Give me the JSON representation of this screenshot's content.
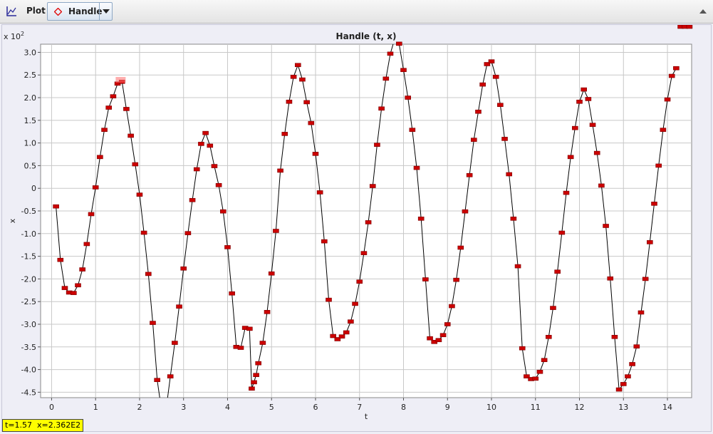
{
  "toolbar": {
    "plot_label": "Plot",
    "handle_label": "Handle",
    "handle_color": "#e00000"
  },
  "readout": "t=1.57  x=2.362E2",
  "chart_data": {
    "type": "line",
    "title": "Handle (t, x)",
    "xlabel": "t",
    "ylabel": "x",
    "y_multiplier": "x 10^2",
    "xlim": [
      -0.25,
      14.55
    ],
    "ylim": [
      -4.62,
      3.18
    ],
    "xticks": [
      0,
      1,
      2,
      3,
      4,
      5,
      6,
      7,
      8,
      9,
      10,
      11,
      12,
      13,
      14
    ],
    "yticks": [
      3.0,
      2.5,
      2.0,
      1.5,
      1.0,
      0.5,
      0,
      -0.5,
      -1.0,
      -1.5,
      -2.0,
      -2.5,
      -3.0,
      -3.5,
      -4.0,
      -4.5
    ],
    "ytick_labels": [
      "3.0",
      "2.5",
      "2.0",
      "1.5",
      "1.0",
      "0.5",
      "0",
      "-0.5",
      "-1.0",
      "-1.5",
      "-2.0",
      "-2.5",
      "-3.0",
      "-3.5",
      "-4.0",
      "-4.5"
    ],
    "grid": true,
    "line_color": "#000000",
    "marker_color": "#cc0000",
    "highlight": {
      "t": 1.57,
      "x": 2.362
    },
    "series": [
      {
        "t": [
          0.1,
          0.2,
          0.3,
          0.4,
          0.5,
          0.6,
          0.7,
          0.8,
          0.9,
          1.0,
          1.1,
          1.2,
          1.3,
          1.4,
          1.5,
          1.6,
          1.7,
          1.8,
          1.9,
          2.0,
          2.1,
          2.2,
          2.3,
          2.4,
          2.5,
          2.6,
          2.7,
          2.8,
          2.9,
          3.0,
          3.1,
          3.2,
          3.3,
          3.4,
          3.5,
          3.6,
          3.7,
          3.8,
          3.9,
          4.0,
          4.1,
          4.2,
          4.3,
          4.4,
          4.5,
          4.55,
          4.6,
          4.65,
          4.7,
          4.8,
          4.9,
          5.0,
          5.1,
          5.2,
          5.3,
          5.4,
          5.5,
          5.6,
          5.7,
          5.8,
          5.9,
          6.0,
          6.1,
          6.2,
          6.3,
          6.4,
          6.5,
          6.6,
          6.7,
          6.8,
          6.9,
          7.0,
          7.1,
          7.2,
          7.3,
          7.4,
          7.5,
          7.6,
          7.7,
          7.8,
          7.9,
          8.0,
          8.1,
          8.2,
          8.3,
          8.4,
          8.5,
          8.6,
          8.7,
          8.8,
          8.9,
          9.0,
          9.1,
          9.2,
          9.3,
          9.4,
          9.5,
          9.6,
          9.7,
          9.8,
          9.9,
          10.0,
          10.1,
          10.2,
          10.3,
          10.4,
          10.5,
          10.6,
          10.7,
          10.8,
          10.9,
          11.0,
          11.1,
          11.2,
          11.3,
          11.4,
          11.5,
          11.6,
          11.7,
          11.8,
          11.9,
          12.0,
          12.1,
          12.2,
          12.3,
          12.4,
          12.5,
          12.6,
          12.7,
          12.8,
          12.9,
          13.0,
          13.1,
          13.2,
          13.3,
          13.4,
          13.5,
          13.6,
          13.7,
          13.8,
          13.9,
          14.0,
          14.1,
          14.2,
          14.3,
          14.4,
          14.5
        ],
        "x": [
          -0.4,
          -1.58,
          -2.2,
          -2.3,
          -2.31,
          -2.14,
          -1.79,
          -1.23,
          -0.57,
          0.02,
          0.69,
          1.29,
          1.78,
          2.03,
          2.31,
          2.35,
          1.75,
          1.16,
          0.53,
          -0.14,
          -0.98,
          -1.89,
          -2.97,
          -4.23,
          -4.9,
          -4.9,
          -4.15,
          -3.41,
          -2.61,
          -1.77,
          -0.99,
          -0.26,
          0.42,
          0.98,
          1.22,
          0.94,
          0.49,
          0.07,
          -0.51,
          -1.3,
          -2.32,
          -3.5,
          -3.52,
          -3.08,
          -3.1,
          -4.42,
          -4.28,
          -4.12,
          -3.86,
          -3.41,
          -2.73,
          -1.88,
          -0.94,
          0.39,
          1.2,
          1.91,
          2.46,
          2.72,
          2.4,
          1.9,
          1.44,
          0.76,
          -0.09,
          -1.17,
          -2.46,
          -3.26,
          -3.33,
          -3.27,
          -3.18,
          -2.94,
          -2.55,
          -2.06,
          -1.43,
          -0.75,
          0.05,
          0.96,
          1.76,
          2.42,
          2.97,
          3.3,
          3.19,
          2.61,
          2.0,
          1.29,
          0.45,
          -0.67,
          -2.01,
          -3.31,
          -3.39,
          -3.35,
          -3.24,
          -3.0,
          -2.6,
          -2.02,
          -1.31,
          -0.51,
          0.29,
          1.07,
          1.69,
          2.29,
          2.74,
          2.8,
          2.46,
          1.84,
          1.09,
          0.31,
          -0.67,
          -1.72,
          -3.53,
          -4.15,
          -4.21,
          -4.2,
          -4.05,
          -3.79,
          -3.28,
          -2.64,
          -1.84,
          -0.98,
          -0.1,
          0.69,
          1.33,
          1.91,
          2.18,
          1.97,
          1.4,
          0.78,
          0.06,
          -0.83,
          -1.99,
          -3.28,
          -4.44,
          -4.32,
          -4.15,
          -3.88,
          -3.49,
          -2.74,
          -2.0,
          -1.19,
          -0.34,
          0.5,
          1.29,
          1.96,
          2.48,
          2.65
        ]
      }
    ]
  }
}
